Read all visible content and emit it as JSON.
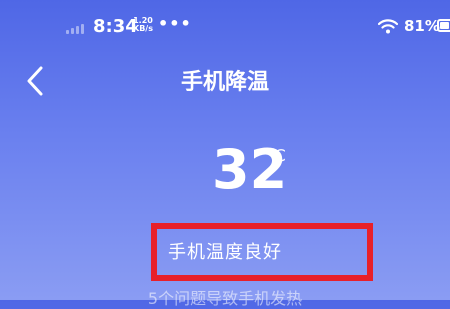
{
  "status_bar": {
    "time": "8:34",
    "net_speed_value": "1.20",
    "net_speed_unit": "KB/s",
    "more": "•••",
    "battery": "81%"
  },
  "header": {
    "title": "手机降温"
  },
  "temperature": {
    "value": "32",
    "unit": "℃"
  },
  "status": {
    "text": "手机温度良好",
    "highlight_color": "#e8202a"
  },
  "issues": {
    "text": "5个问题导致手机发热"
  },
  "colors": {
    "background_top": "#4f67e6",
    "background_bottom": "#8a9cf3"
  }
}
